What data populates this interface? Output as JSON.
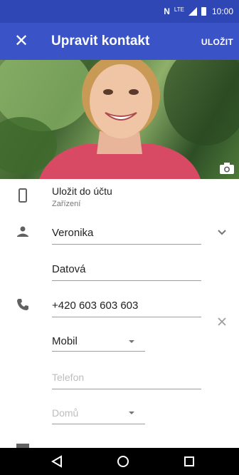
{
  "status_bar": {
    "nfc": "N",
    "network": "LTE",
    "time": "10:00"
  },
  "app_bar": {
    "close_icon": "close-icon",
    "title": "Upravit kontakt",
    "save_label": "ULOŽIT"
  },
  "account": {
    "title": "Uložit do účtu",
    "subtitle": "Zařízení"
  },
  "name": {
    "first": "Veronika",
    "last": "Datová"
  },
  "phone": {
    "number": "+420 603 603 603",
    "type": "Mobil",
    "placeholder": "Telefon",
    "placeholder_type": "Domů"
  },
  "colors": {
    "primary": "#3a53c6",
    "primary_dark": "#2f47b4"
  }
}
